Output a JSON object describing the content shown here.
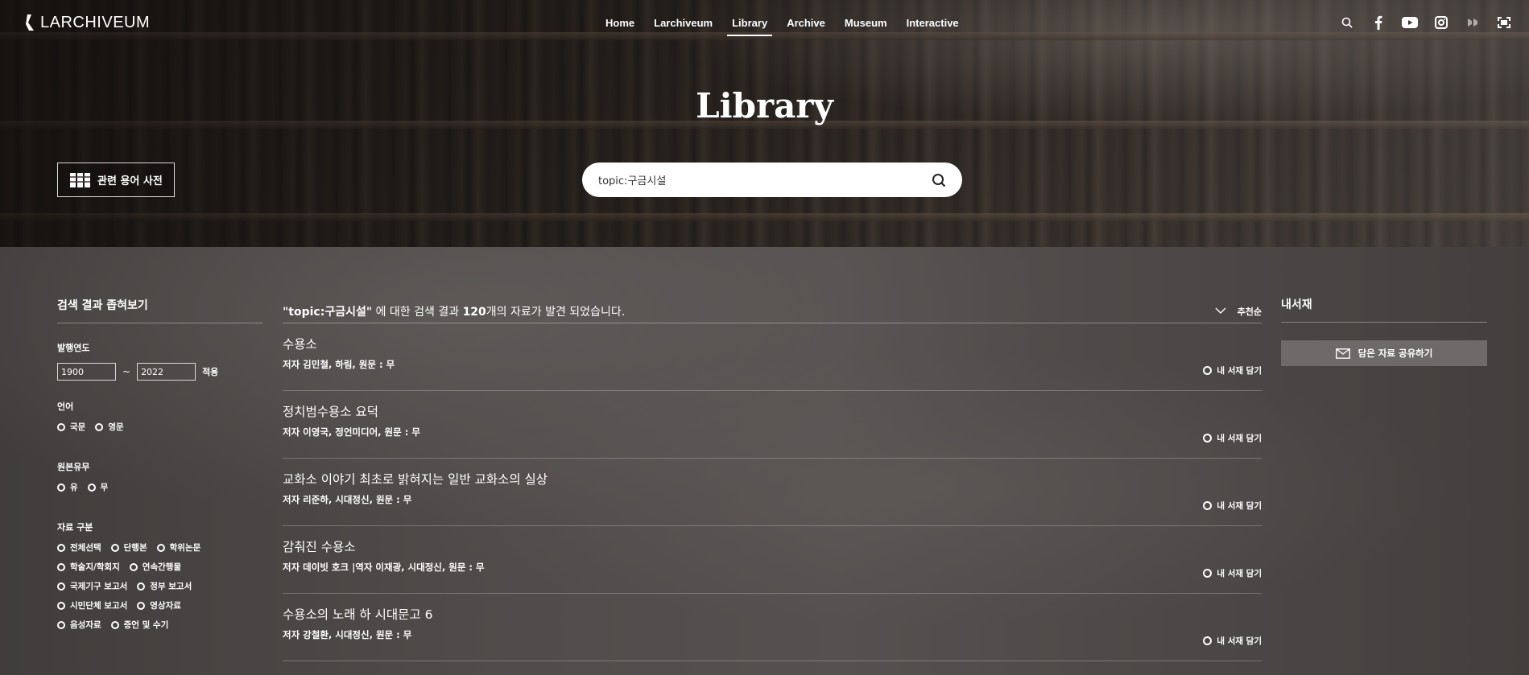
{
  "header": {
    "logo_text": "LARCHIVEUM",
    "nav": [
      {
        "label": "Home",
        "active": false
      },
      {
        "label": "Larchiveum",
        "active": false
      },
      {
        "label": "Library",
        "active": true
      },
      {
        "label": "Archive",
        "active": false
      },
      {
        "label": "Museum",
        "active": false
      },
      {
        "label": "Interactive",
        "active": false
      }
    ],
    "icons": [
      "search-icon",
      "facebook-icon",
      "youtube-icon",
      "instagram-icon",
      "vr-icon",
      "fullscreen-icon"
    ]
  },
  "hero": {
    "title": "Library",
    "dictionary_button": "관련 용어 사전",
    "search_value": "topic:구금시설"
  },
  "filters": {
    "heading": "검색 결과 좁혀보기",
    "year": {
      "label": "발행연도",
      "from": "1900",
      "to": "2022",
      "apply": "적용",
      "sep": "~"
    },
    "language": {
      "label": "언어",
      "options": [
        "국문",
        "영문"
      ]
    },
    "original": {
      "label": "원본유무",
      "options": [
        "유",
        "무"
      ]
    },
    "material": {
      "label": "자료 구분",
      "rows": [
        [
          "전체선택",
          "단행본",
          "학위논문"
        ],
        [
          "학술지/학회지",
          "연속간행물"
        ],
        [
          "국제기구 보고서",
          "정부 보고서"
        ],
        [
          "시민단체 보고서",
          "영상자료"
        ],
        [
          "음성자료",
          "증언 및 수기"
        ]
      ]
    }
  },
  "results": {
    "query": "\"topic:구금시설\"",
    "summary_pre": " 에 대한 검색 결과 ",
    "count": "120",
    "summary_post": "개의 자료가 발견 되었습니다.",
    "sort_label": "추천순",
    "shelf_label": "내 서재 담기",
    "items": [
      {
        "title": "수용소",
        "meta": "저자 김민철, 하림, 원문 : 무"
      },
      {
        "title": "정치범수용소 요덕",
        "meta": "저자 이영국, 정언미디어, 원문 : 무"
      },
      {
        "title": "교화소 이야기 최초로 밝혀지는 일반 교화소의 실상",
        "meta": "저자 리준하, 시대정신, 원문 : 무"
      },
      {
        "title": "감춰진 수용소",
        "meta": "저자 데이빗 호크 |역자 이재광, 시대정신, 원문 : 무"
      },
      {
        "title": "수용소의 노래 하 시대문고 6",
        "meta": "저자 강철환, 시대정신, 원문 : 무"
      }
    ]
  },
  "bookshelf": {
    "heading": "내서재",
    "share_button": "담은 자료 공유하기"
  }
}
